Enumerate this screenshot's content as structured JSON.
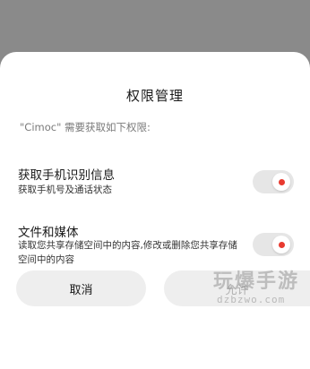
{
  "dialog": {
    "title": "权限管理",
    "subtitle": "\"Cimoc\" 需要获取如下权限:"
  },
  "permissions": [
    {
      "title": "获取手机识别信息",
      "desc": "获取手机号及通话状态",
      "enabled": true
    },
    {
      "title": "文件和媒体",
      "desc": "读取您共享存储空间中的内容,修改或删除您共享存储空间中的内容",
      "enabled": true
    }
  ],
  "buttons": {
    "cancel_label": "取消",
    "allow_label": "允许"
  },
  "colors": {
    "overlay": "#8a8a8a",
    "toggle_dot": "#e83a2f",
    "toggle_track": "#e6e6e6"
  },
  "watermark": {
    "text": "玩爆手游",
    "url": "dzbzwo.com"
  }
}
